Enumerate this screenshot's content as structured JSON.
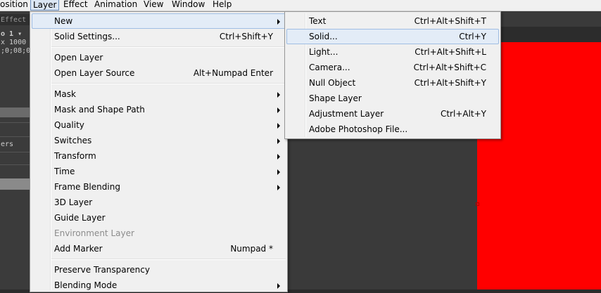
{
  "menubar": {
    "items": [
      "osition",
      "Layer",
      "Effect",
      "Animation",
      "View",
      "Window",
      "Help"
    ]
  },
  "left_panel": {
    "tab": "Effect C",
    "comp_name": "o 1 ▾",
    "comp_size": "x 1000 (",
    "timecode": ";0;08;00, ",
    "layers_label": "ers"
  },
  "layer_menu": {
    "groups": [
      [
        {
          "label": "New",
          "submenu": true
        },
        {
          "label": "Solid Settings...",
          "shortcut": "Ctrl+Shift+Y"
        }
      ],
      [
        {
          "label": "Open Layer"
        },
        {
          "label": "Open Layer Source",
          "shortcut": "Alt+Numpad Enter"
        }
      ],
      [
        {
          "label": "Mask",
          "submenu": true
        },
        {
          "label": "Mask and Shape Path",
          "submenu": true
        },
        {
          "label": "Quality",
          "submenu": true
        },
        {
          "label": "Switches",
          "submenu": true
        },
        {
          "label": "Transform",
          "submenu": true
        },
        {
          "label": "Time",
          "submenu": true
        },
        {
          "label": "Frame Blending",
          "submenu": true
        },
        {
          "label": "3D Layer"
        },
        {
          "label": "Guide Layer"
        },
        {
          "label": "Environment Layer",
          "disabled": true
        },
        {
          "label": "Add Marker",
          "shortcut": "Numpad *"
        }
      ],
      [
        {
          "label": "Preserve Transparency"
        },
        {
          "label": "Blending Mode",
          "submenu": true
        }
      ]
    ]
  },
  "new_submenu": {
    "items": [
      {
        "label": "Text",
        "shortcut": "Ctrl+Alt+Shift+T"
      },
      {
        "label": "Solid...",
        "shortcut": "Ctrl+Y",
        "highlighted": true
      },
      {
        "label": "Light...",
        "shortcut": "Ctrl+Alt+Shift+L"
      },
      {
        "label": "Camera...",
        "shortcut": "Ctrl+Alt+Shift+C"
      },
      {
        "label": "Null Object",
        "shortcut": "Ctrl+Alt+Shift+Y"
      },
      {
        "label": "Shape Layer"
      },
      {
        "label": "Adjustment Layer",
        "shortcut": "Ctrl+Alt+Y"
      },
      {
        "label": "Adobe Photoshop File..."
      }
    ]
  },
  "colors": {
    "solid_layer": "#ff0000",
    "highlight": "#e3ecf7",
    "menu_bg": "#f0f0f0"
  }
}
